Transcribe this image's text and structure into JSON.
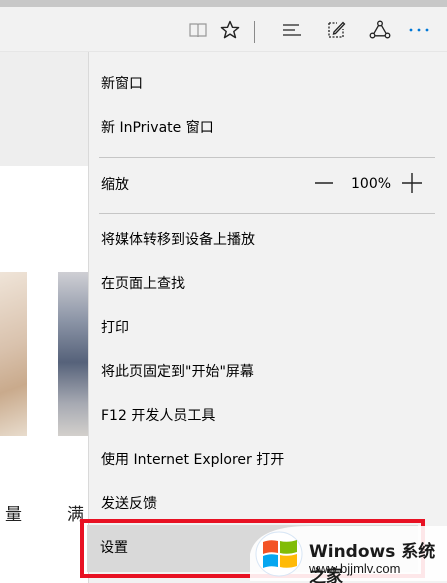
{
  "toolbar": {
    "icons": [
      "reading-view-icon",
      "favorite-star-icon",
      "hub-icon",
      "web-note-icon",
      "share-icon",
      "more-icon"
    ],
    "accent_color": "#0078d7"
  },
  "page": {
    "caption_left": "量",
    "caption_right": "满"
  },
  "menu": {
    "new_window": "新窗口",
    "new_inprivate_window": "新 InPrivate 窗口",
    "zoom_label": "缩放",
    "zoom_value": "100%",
    "cast_media": "将媒体转移到设备上播放",
    "find_on_page": "在页面上查找",
    "print": "打印",
    "pin_to_start": "将此页固定到\"开始\"屏幕",
    "f12_dev_tools": "F12 开发人员工具",
    "open_with_ie": "使用 Internet Explorer 打开",
    "send_feedback": "发送反馈",
    "settings": "设置",
    "highlight_color": "#e81123"
  },
  "watermark": {
    "brand": "Windows 系统之家",
    "site": "www.bjjmlv.com"
  }
}
